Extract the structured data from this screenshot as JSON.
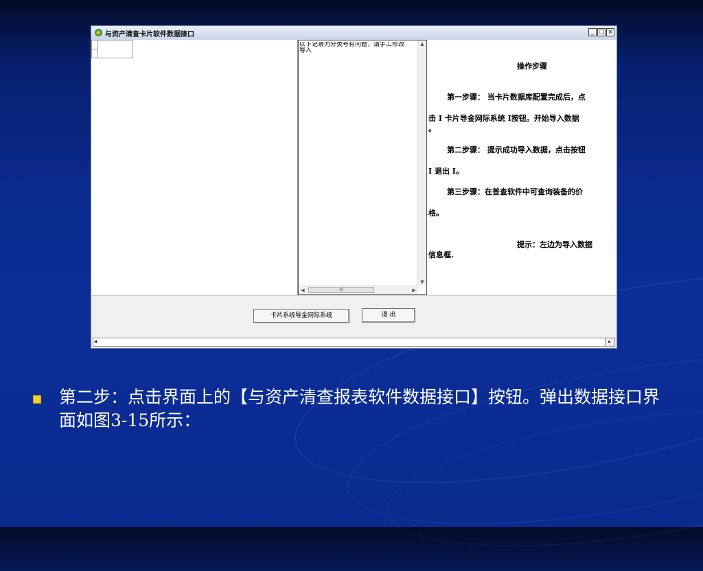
{
  "window": {
    "title": "与资产清查卡片软件数据接口",
    "controls": {
      "minimize": "_",
      "maximize": "□",
      "close": "×"
    }
  },
  "middle_panel": {
    "text": "以下记录为分类号有问题，请手工修改\n导入",
    "scrollbar_thumb": "III"
  },
  "instructions": {
    "heading": "操作步骤",
    "step1_line1": "第一步骤： 当卡片数据库配置完成后，点",
    "step1_line2": "击 Ⅰ 卡片导金网际系统 Ⅰ按钮。开始导入数据",
    "step1_line3": "。",
    "step2_line1": "第二步骤： 提示成功导入数据，点击按钮",
    "step2_line2": "Ⅰ 退出 Ⅰ。",
    "step3_line1": "第三步骤：在普查软件中可查询装备的价",
    "step3_line2": "格。",
    "tip_line1": "提示：左边为导入数据",
    "tip_line2": "信息框."
  },
  "buttons": {
    "import": "卡片系统导金网际系统",
    "exit": "退  出"
  },
  "slide": {
    "bullet_text": "第二步：点击界面上的【与资产清查报表软件数据接口】按钮。弹出数据接口界面如图3-15所示："
  },
  "colors": {
    "bullet": "#f2d02a",
    "background": "#0a2a8c"
  },
  "icons": [
    "app-icon",
    "scroll-up-icon",
    "scroll-down-icon",
    "scroll-left-icon",
    "scroll-right-icon"
  ]
}
